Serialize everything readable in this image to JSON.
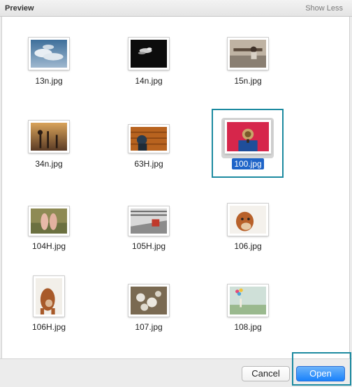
{
  "header": {
    "title": "Preview",
    "show_less": "Show Less"
  },
  "files": [
    {
      "name": "13n.jpg",
      "icon": "photo-thumbnail-icon"
    },
    {
      "name": "14n.jpg",
      "icon": "photo-thumbnail-icon"
    },
    {
      "name": "15n.jpg",
      "icon": "photo-thumbnail-icon"
    },
    {
      "name": "34n.jpg",
      "icon": "photo-thumbnail-icon"
    },
    {
      "name": "63H.jpg",
      "icon": "photo-thumbnail-icon"
    },
    {
      "name": "100.jpg",
      "icon": "photo-thumbnail-icon",
      "selected": true
    },
    {
      "name": "104H.jpg",
      "icon": "photo-thumbnail-icon"
    },
    {
      "name": "105H.jpg",
      "icon": "photo-thumbnail-icon"
    },
    {
      "name": "106.jpg",
      "icon": "photo-thumbnail-icon"
    },
    {
      "name": "106H.jpg",
      "icon": "photo-thumbnail-icon"
    },
    {
      "name": "107.jpg",
      "icon": "photo-thumbnail-icon"
    },
    {
      "name": "108.jpg",
      "icon": "photo-thumbnail-icon"
    }
  ],
  "footer": {
    "cancel_label": "Cancel",
    "open_label": "Open"
  },
  "colors": {
    "selection": "#1e64c8",
    "accent": "#1a82fb",
    "highlight_box": "#1c8aa0"
  }
}
